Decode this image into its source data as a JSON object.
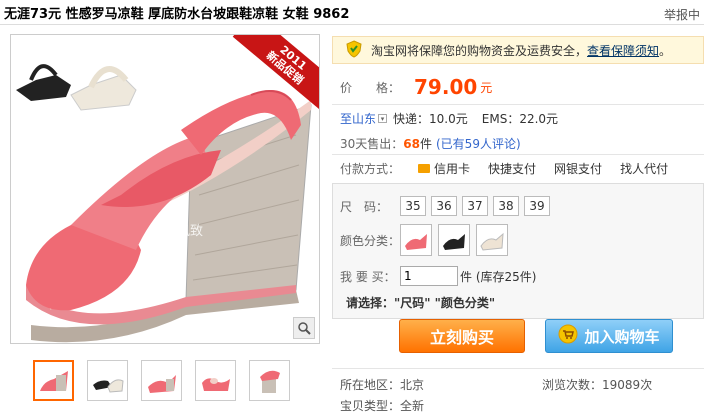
{
  "header": {
    "title": "无涯73元 性感罗马凉鞋 厚底防水台坡跟鞋凉鞋 女鞋 9862",
    "report": "举报中"
  },
  "main_image": {
    "ribbon_line1": "2011",
    "ribbon_line2": "新品促销",
    "watermark": "时代风致",
    "zoom_icon": "magnifier-icon"
  },
  "thumbnails": [
    "thumb-1",
    "thumb-2",
    "thumb-3",
    "thumb-4",
    "thumb-5"
  ],
  "notice": {
    "text": "淘宝网将保障您的购物资金及运费安全，",
    "link": "查看保障须知",
    "suffix": "。"
  },
  "price": {
    "label": "价　　格：",
    "value": "79.00",
    "unit": "元"
  },
  "shipping": {
    "prefix": "至",
    "region": "山东",
    "express": "快递：10.0元",
    "ems": "EMS：22.0元"
  },
  "sales": {
    "label": "30天售出：",
    "count": "68",
    "unit": "件",
    "reviews": "(已有59人评论)"
  },
  "payment": {
    "label": "付款方式：",
    "options": [
      "信用卡",
      "快捷支付",
      "网银支付",
      "找人代付"
    ]
  },
  "sku": {
    "size_label": "尺　码：",
    "sizes": [
      "35",
      "36",
      "37",
      "38",
      "39"
    ],
    "color_label": "颜色分类：",
    "qty_label": "我 要 买：",
    "qty_value": "1",
    "qty_unit": "件 (库存25件)",
    "choose": "请选择：\"尺码\" \"颜色分类\""
  },
  "actions": {
    "buy": "立刻购买",
    "cart": "加入购物车"
  },
  "details": {
    "location_label": "所在地区：",
    "location": "北京",
    "views_label": "浏览次数：",
    "views": "19089次",
    "condition_label": "宝贝类型：",
    "condition": "全新"
  },
  "colors": {
    "price": "#ff4400",
    "buy": "#ff7200",
    "cart": "#3fa4e6",
    "shoe": "#ef6a74"
  }
}
